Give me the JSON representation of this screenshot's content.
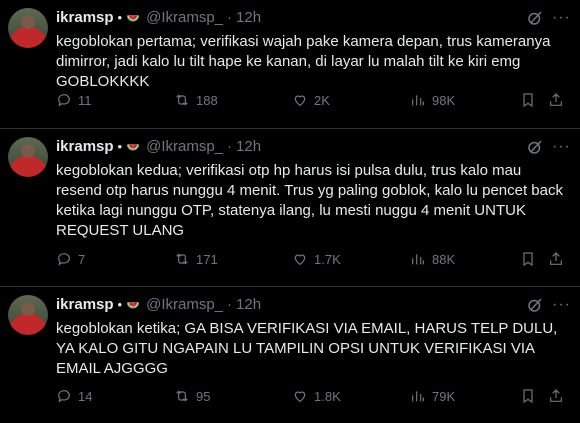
{
  "tweets": [
    {
      "name": "ikramsp",
      "handle": "@Ikramsp_",
      "time": "12h",
      "text": "kegoblokan pertama; verifikasi wajah pake kamera depan, trus kameranya dimirror, jadi kalo lu tilt hape ke kanan, di layar lu malah tilt ke kiri emg GOBLOKKKK",
      "replies": "11",
      "reposts": "188",
      "likes": "2K",
      "views": "98K"
    },
    {
      "name": "ikramsp",
      "handle": "@Ikramsp_",
      "time": "12h",
      "text": "kegoblokan kedua; verifikasi otp hp harus isi pulsa dulu, trus kalo mau resend otp harus nunggu 4 menit. Trus yg paling goblok, kalo lu pencet back ketika lagi nunggu OTP, statenya ilang, lu mesti nuggu 4 menit UNTUK REQUEST ULANG",
      "replies": "7",
      "reposts": "171",
      "likes": "1.7K",
      "views": "88K"
    },
    {
      "name": "ikramsp",
      "handle": "@Ikramsp_",
      "time": "12h",
      "text": "kegoblokan ketika; GA BISA VERIFIKASI VIA EMAIL, HARUS TELP DULU, YA KALO GITU NGAPAIN LU TAMPILIN OPSI UNTUK VERIFIKASI VIA EMAIL AJGGGG",
      "replies": "14",
      "reposts": "95",
      "likes": "1.8K",
      "views": "79K"
    }
  ],
  "separator_dot": "•",
  "time_separator": "·",
  "more_glyph": "···",
  "icons": [
    "avatar",
    "watermelon-emoji-icon",
    "grok-icon",
    "more-icon",
    "reply-icon",
    "repost-icon",
    "like-icon",
    "views-icon",
    "bookmark-icon",
    "share-icon"
  ],
  "colors": {
    "background": "#000000",
    "text": "#e7e9ea",
    "muted": "#71767b",
    "divider": "#2f3336"
  }
}
